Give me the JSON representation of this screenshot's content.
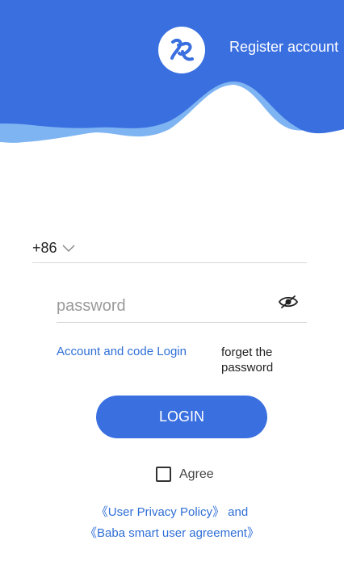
{
  "header": {
    "register_label": "Register account",
    "colors": {
      "primary": "#3a6fe0",
      "wave_light": "#7fb4f2",
      "background": "#ffffff"
    }
  },
  "form": {
    "country_code": "+86",
    "password_placeholder": "password"
  },
  "links": {
    "code_login": "Account and code Login",
    "forget_password": "forget the password"
  },
  "login_button": "LOGIN",
  "agree_label": "Agree",
  "policy": {
    "privacy": "《User Privacy Policy》",
    "and": "and",
    "agreement": "《Baba smart user agreement》"
  },
  "icons": [
    "app-logo-icon",
    "chevron-down-icon",
    "eye-hidden-icon",
    "checkbox-icon"
  ]
}
